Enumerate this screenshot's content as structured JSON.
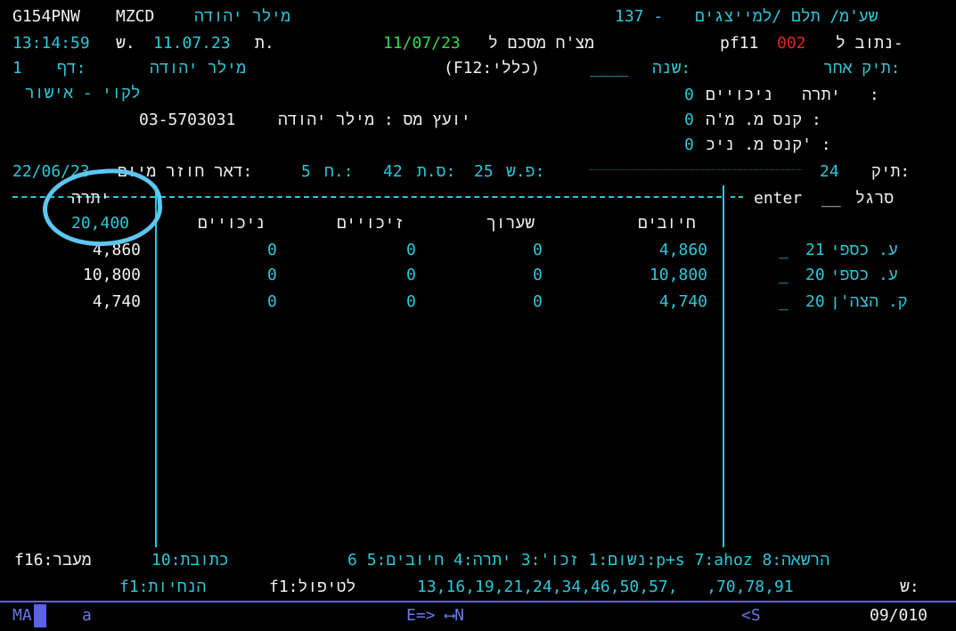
{
  "header": {
    "program_id": "G154PNW",
    "screen_code": "MZCD",
    "client_name_top": "מילר יהודה",
    "screen_number": "137 -",
    "screen_title": "שע'מ/ תלם /למייצגים",
    "time": "13:14:59",
    "sh_label": "ש.",
    "date": "11.07.23",
    "t_label": "ת.",
    "summary_date": "11/07/23",
    "summary_label": "מצ'ח מסכם ל",
    "pf_key": "pf11",
    "route_code": "002",
    "route_label": "נתוב ל-",
    "page_label": "דף:",
    "page_value": "1",
    "client_name_2": "מילר יהודה",
    "general_f12": "(F12:כללי)",
    "year_label": "שנה:",
    "year_value": "____",
    "other_file_label": "תיק אחר:",
    "status_text": "לקוי - אישור",
    "advisor_label": "יועץ מס : מילר יהודה",
    "advisor_phone": "03-5703031"
  },
  "balances": [
    {
      "label": "יתרה   ניכויים   :",
      "value": "0"
    },
    {
      "label": "קנס מ. מ'ה :",
      "value": "0"
    },
    {
      "label": "קנס מ. ניכ' :",
      "value": "0"
    }
  ],
  "file_line": {
    "file_label": "תיק:",
    "file_tail": "24",
    "ps_label": "פ.ש:",
    "ps_value": "25",
    "st_label": "ס.ת:",
    "st_value": "42",
    "h_label": "ח.:",
    "h_value": "5",
    "mail_label": "דאר חוזר מיום:",
    "mail_date": "22/06/23"
  },
  "table": {
    "sargel_label": "סרגל",
    "enter_label": "enter",
    "columns": {
      "debits": "חיובים",
      "arrears": "שערוך",
      "credits": "זיכויים",
      "deductions": "ניכויים",
      "balance": "יתרה"
    },
    "rows": [
      {
        "select": "_",
        "year": "21",
        "type": "ע. כספי",
        "debits": "4,860",
        "arrears": "0",
        "credits": "0",
        "deductions": "0",
        "balance": "4,860"
      },
      {
        "select": "_",
        "year": "20",
        "type": "ע. כספי",
        "debits": "10,800",
        "arrears": "0",
        "credits": "0",
        "deductions": "0",
        "balance": "10,800"
      },
      {
        "select": "_",
        "year": "20",
        "type": "ק. הצה'ן",
        "debits": "4,740",
        "arrears": "0",
        "credits": "0",
        "deductions": "0",
        "balance": "4,740"
      }
    ],
    "total_balance": "20,400"
  },
  "footer": {
    "function_keys": "נשום:1 זכו':3 יתרה:4 חיובים:5 6:p+s 7:ahoz הרשאה:8",
    "address_key": "כתובת:10",
    "transfer_key": "f16:מעבר",
    "codes_label": "ש:",
    "codes": "13,16,19,21,24,34,46,50,57,   ,70,78,91",
    "treatment_key": "f1:לטיפול",
    "guidance_key": "f1:הנחיות"
  },
  "statusbar": {
    "mode": "MA",
    "session": "a",
    "keys": "E=> ⟷N",
    "back": "<S",
    "position": "09/010"
  },
  "colors": {
    "background": "#000000",
    "cyan_text": "#2ec8d8",
    "white_text": "#f2f2f2",
    "green_text": "#39d84a",
    "red_text": "#e82424",
    "annotation_circle": "#5ec6f0"
  }
}
